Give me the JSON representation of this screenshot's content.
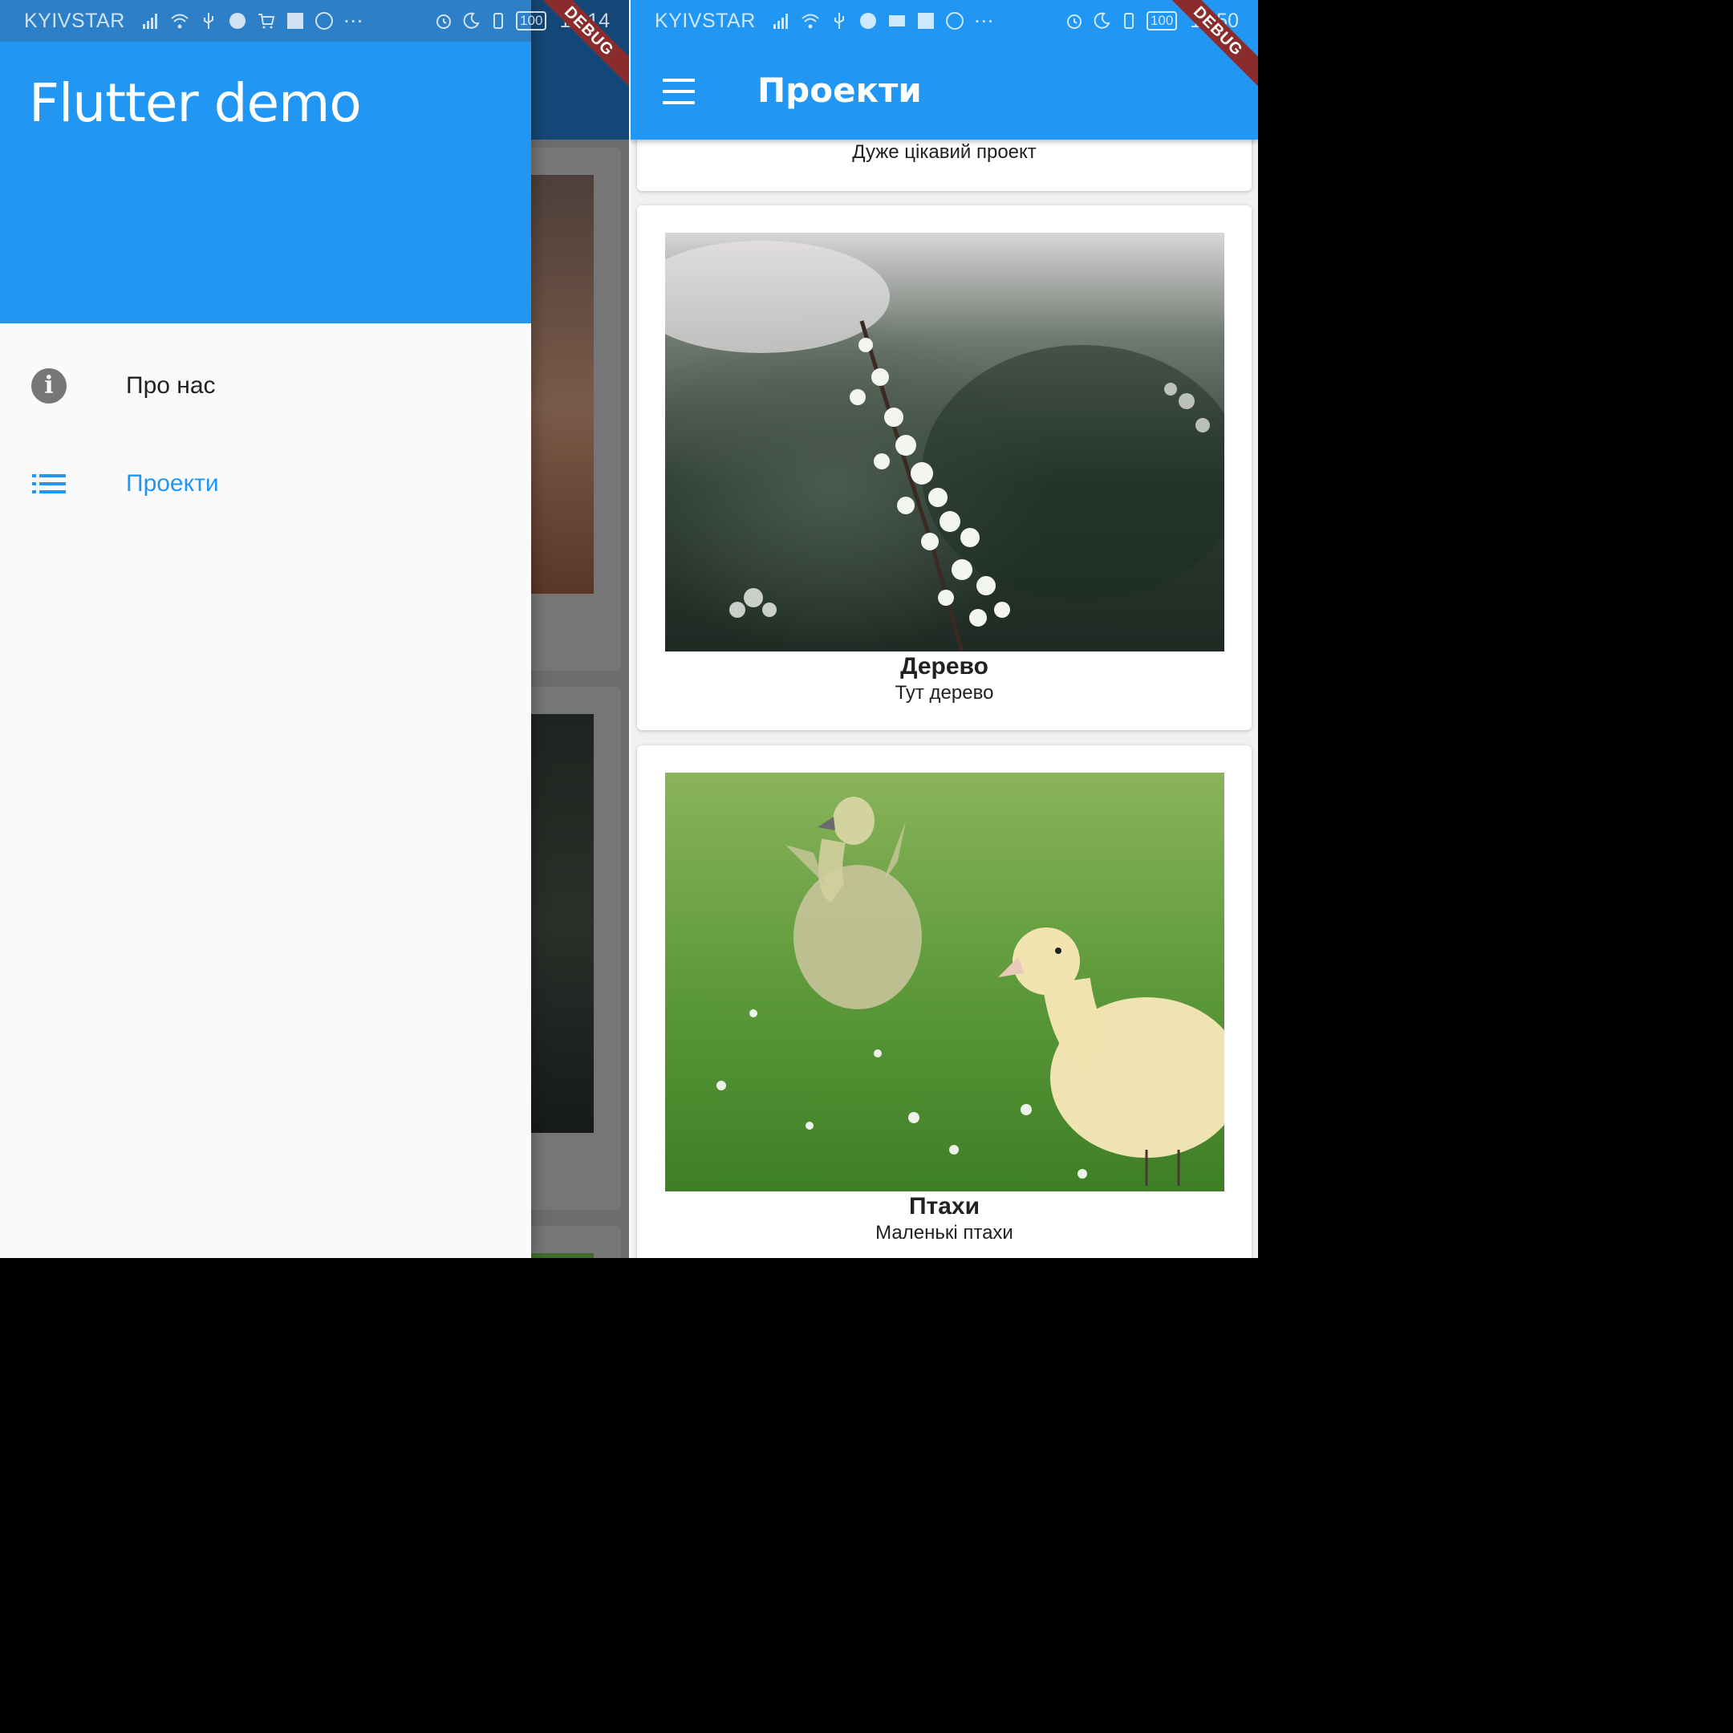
{
  "status_left": {
    "carrier": "KYIVSTAR",
    "battery": "100",
    "clock": "14:14",
    "debug": "DEBUG"
  },
  "status_right": {
    "carrier": "KYIVSTAR",
    "battery": "100",
    "clock": "11:50",
    "debug": "DEBUG"
  },
  "drawer": {
    "title": "Flutter demo",
    "items": [
      {
        "label": "Про нас",
        "icon": "info-icon",
        "selected": false
      },
      {
        "label": "Проекти",
        "icon": "list-icon",
        "selected": true
      }
    ]
  },
  "projects_screen": {
    "title": "Проекти",
    "cards": [
      {
        "subtitle": "Дуже цікавий проект"
      },
      {
        "title": "Дерево",
        "subtitle": "Тут дерево",
        "image": "blossom-branch"
      },
      {
        "title": "Птахи",
        "subtitle": "Маленькі птахи",
        "image": "ducklings-on-grass"
      }
    ]
  },
  "colors": {
    "primary": "#2196f3",
    "selected_item": "#2196f3",
    "debug_banner": "#8b2b2b"
  }
}
